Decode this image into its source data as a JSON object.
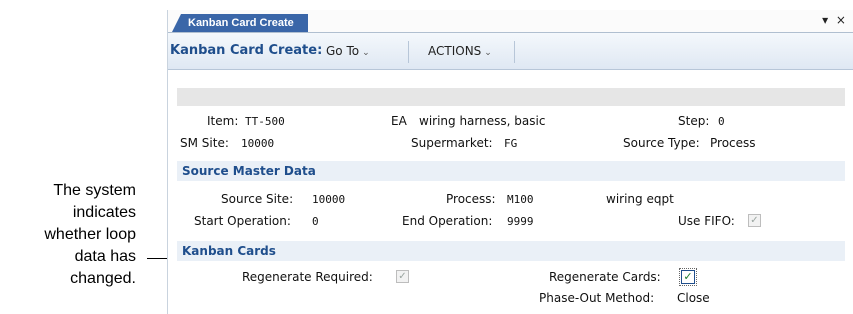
{
  "callout": {
    "lines": [
      "The system",
      "indicates",
      "whether loop",
      "data has",
      "changed."
    ]
  },
  "tab": {
    "label": "Kanban Card Create"
  },
  "window_controls": "▾ ×",
  "toolbar": {
    "title": "Kanban Card Create:",
    "goto_label": "Go To",
    "actions_label": "ACTIONS"
  },
  "header": {
    "item_label": "Item:",
    "item_value": "TT-500",
    "um_value": "EA",
    "item_desc": "wiring harness, basic",
    "step_label": "Step:",
    "step_value": "0",
    "sm_site_label": "SM Site:",
    "sm_site_value": "10000",
    "supermarket_label": "Supermarket:",
    "supermarket_value": "FG",
    "source_type_label": "Source Type:",
    "source_type_value": "Process"
  },
  "source_master": {
    "title": "Source Master Data",
    "source_site_label": "Source Site:",
    "source_site_value": "10000",
    "process_label": "Process:",
    "process_value": "M100",
    "process_desc": "wiring eqpt",
    "start_op_label": "Start Operation:",
    "start_op_value": "0",
    "end_op_label": "End Operation:",
    "end_op_value": "9999",
    "use_fifo_label": "Use FIFO:",
    "use_fifo_checked": true
  },
  "kanban_cards": {
    "title": "Kanban Cards",
    "regen_required_label": "Regenerate Required:",
    "regen_required_checked": true,
    "regen_cards_label": "Regenerate Cards:",
    "regen_cards_checked": true,
    "phase_out_label": "Phase-Out Method:",
    "phase_out_value": "Close"
  },
  "colors": {
    "tab_bg": "#3a66a8",
    "title_text": "#1f4e8c",
    "section_bg": "#eaf0f7"
  }
}
